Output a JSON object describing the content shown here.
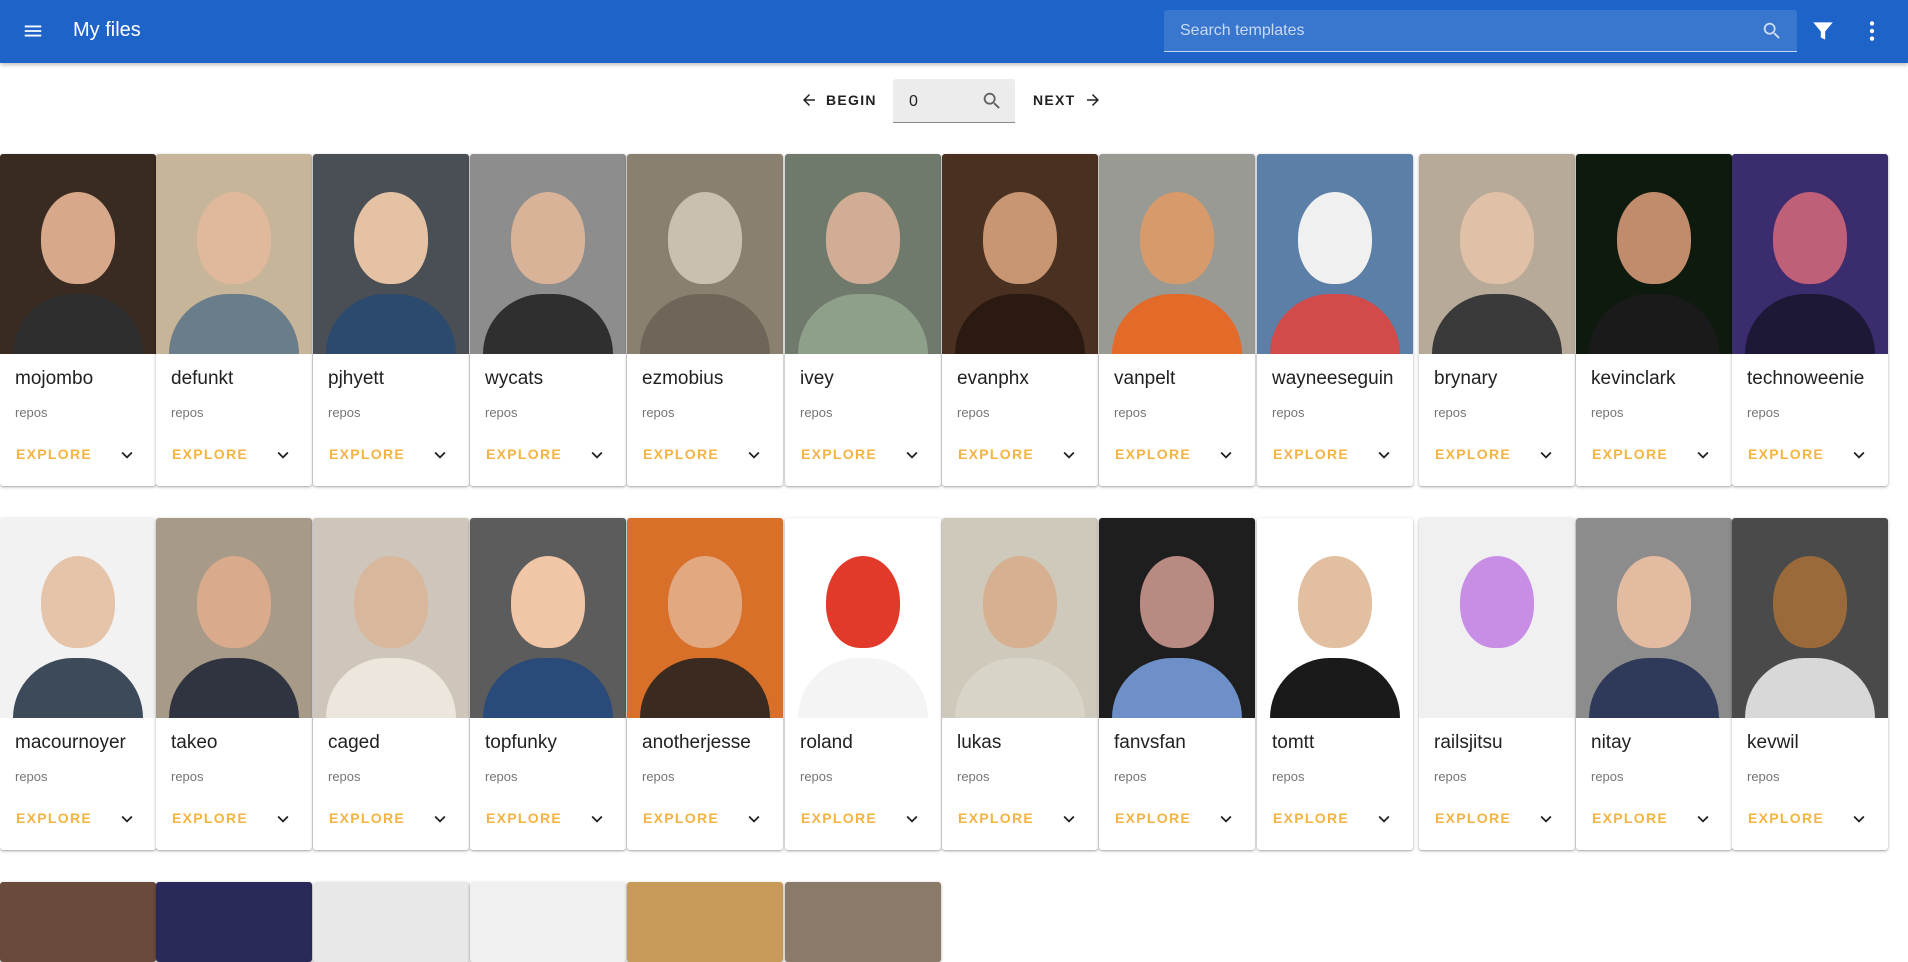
{
  "app": {
    "title": "My files",
    "search_placeholder": "Search templates"
  },
  "pager": {
    "begin_label": "BEGIN",
    "page_value": "0",
    "next_label": "NEXT"
  },
  "card_labels": {
    "subtitle": "repos",
    "action": "EXPLORE"
  },
  "colors": {
    "appbar": "#1e64c8",
    "accent": "#f5b342"
  },
  "rows": [
    [
      "mojombo",
      "defunkt",
      "pjhyett",
      "wycats",
      "ezmobius",
      "ivey",
      "evanphx",
      "vanpelt",
      "wayneeseguin",
      "brynary",
      "kevinclark",
      "technoweenie"
    ],
    [
      "macournoyer",
      "takeo",
      "caged",
      "topfunky",
      "anotherjesse",
      "roland",
      "lukas",
      "fanvsfan",
      "tomtt",
      "railsjitsu",
      "nitay",
      "kevwil"
    ]
  ],
  "partial_row_count": 6
}
